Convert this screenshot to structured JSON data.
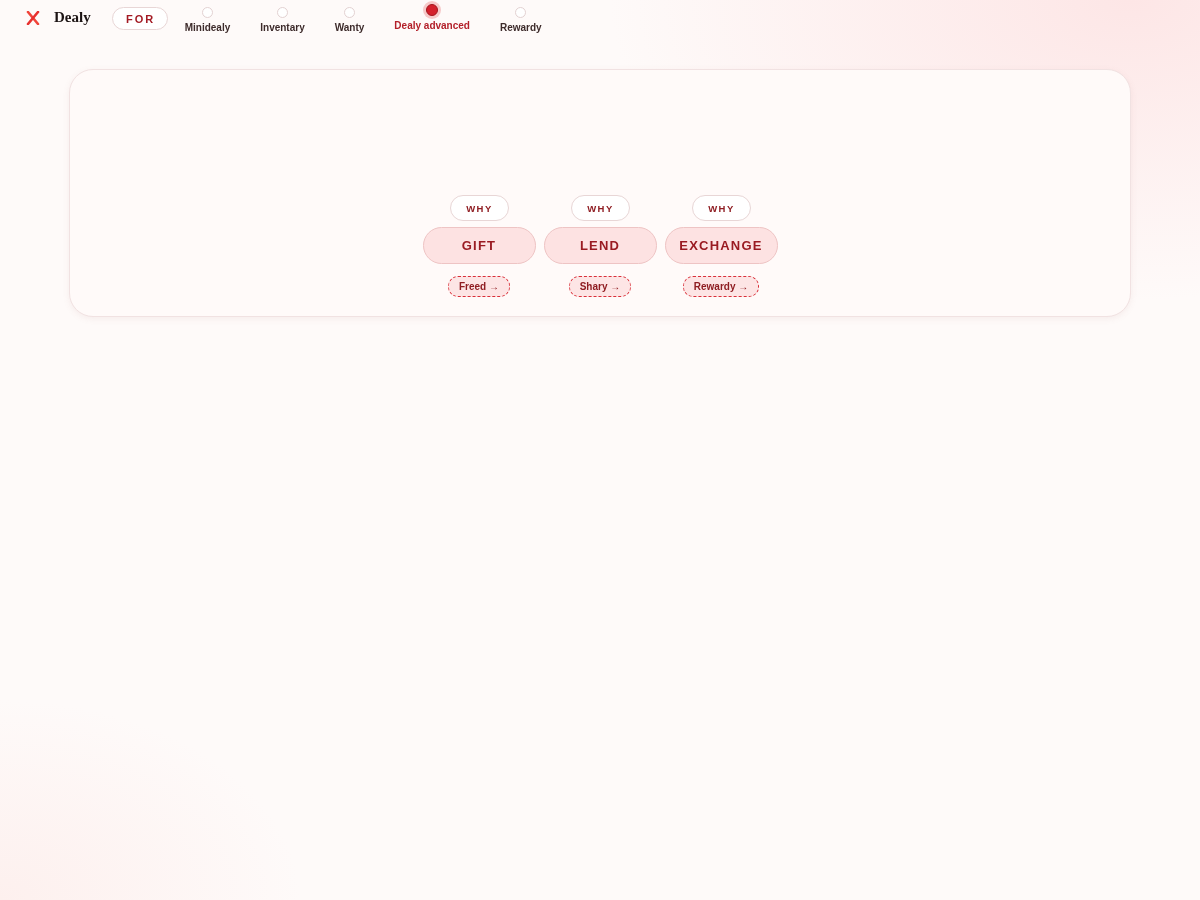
{
  "brand": {
    "name": "Dealy"
  },
  "for_pill": "FOR",
  "steps": [
    {
      "label": "Minidealy",
      "selected": false
    },
    {
      "label": "Inventary",
      "selected": false
    },
    {
      "label": "Wanty",
      "selected": false
    },
    {
      "label": "Dealy advanced",
      "selected": true
    },
    {
      "label": "Rewardy",
      "selected": false
    }
  ],
  "options": [
    {
      "why": "WHY",
      "label": "GIFT",
      "link": "Freed →"
    },
    {
      "why": "WHY",
      "label": "LEND",
      "link": "Shary →"
    },
    {
      "why": "WHY",
      "label": "EXCHANGE",
      "link": "Rewardy →"
    }
  ]
}
